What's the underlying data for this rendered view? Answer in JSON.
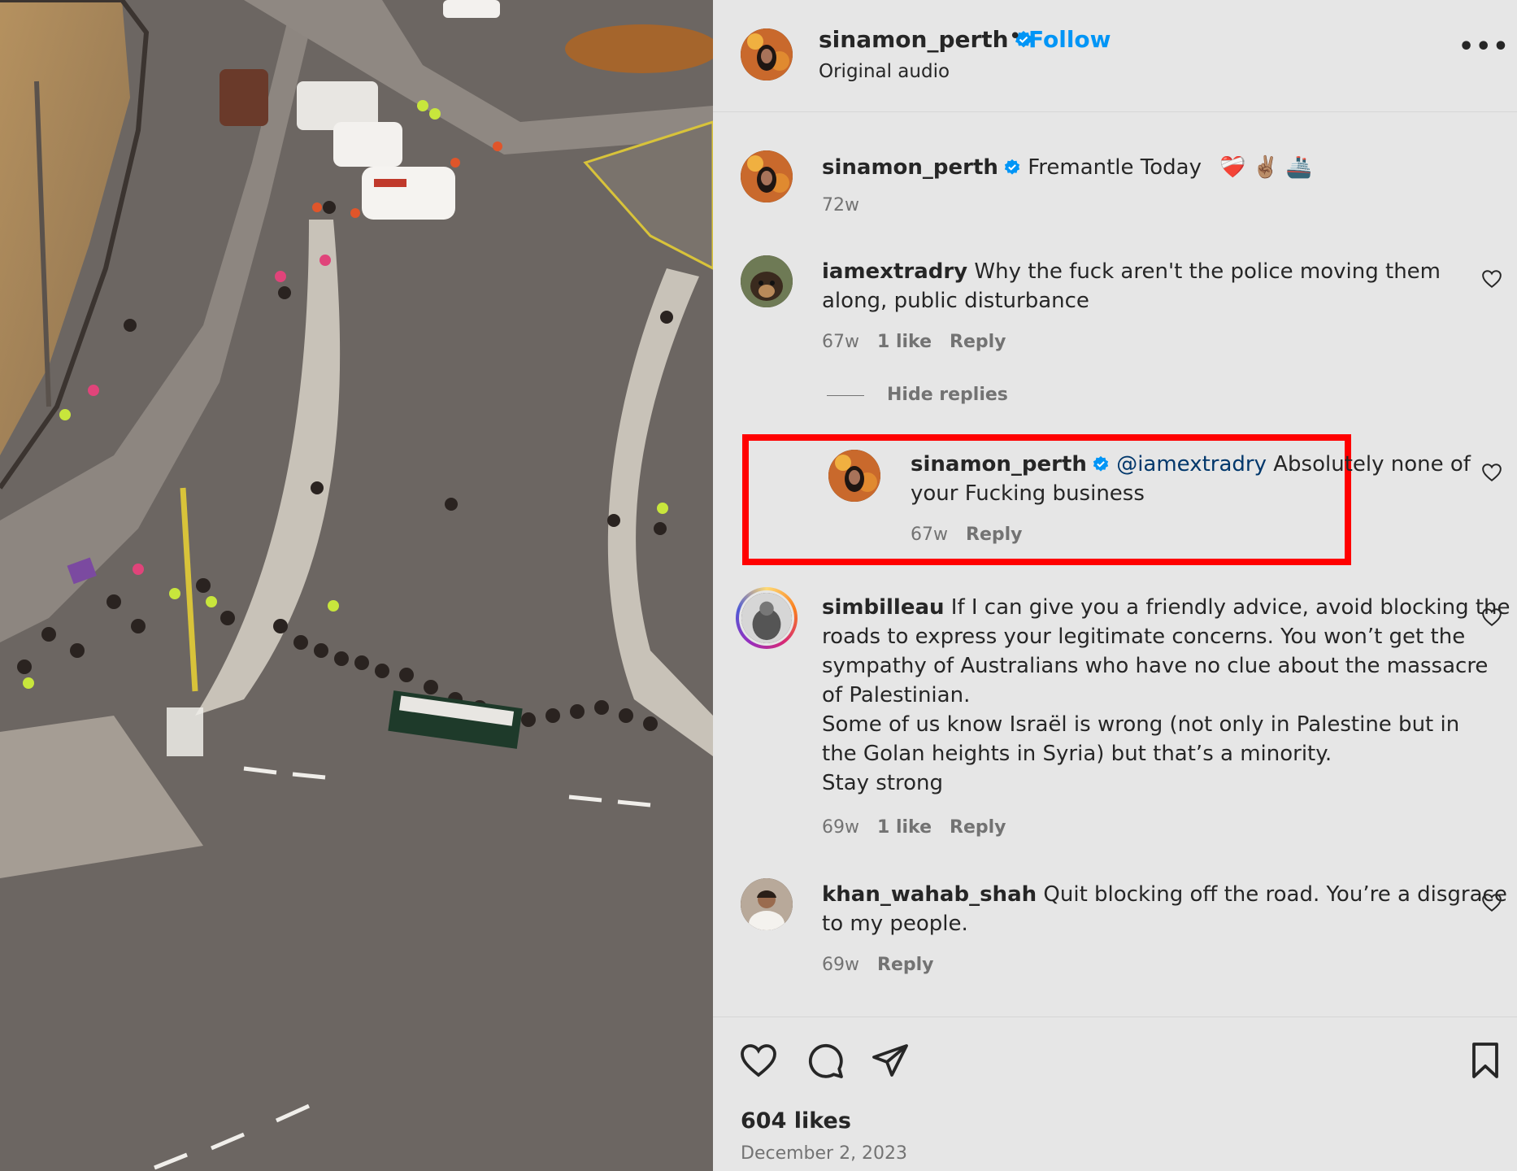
{
  "header": {
    "username": "sinamon_perth",
    "separator": "•",
    "follow_label": "Follow",
    "audio": "Original audio",
    "more_label": "•••"
  },
  "caption": {
    "username": "sinamon_perth",
    "text": "Fremantle Today",
    "emojis": "❤️‍🩹 ✌🏽 🚢",
    "age": "72w"
  },
  "comments": [
    {
      "username": "iamextradry",
      "text": "Why the fuck aren't the police moving them along, public disturbance",
      "line1": "Why the fuck aren't the police moving them",
      "line2": "along, public disturbance",
      "age": "67w",
      "likes": "1 like",
      "reply_label": "Reply"
    },
    {
      "hide_replies_label": "Hide replies"
    },
    {
      "username": "sinamon_perth",
      "mention": "@iamextradry",
      "text_after_mention": "Absolutely none of",
      "line2": "your Fucking business",
      "age": "67w",
      "reply_label": "Reply"
    },
    {
      "username": "simbilleau",
      "lines": [
        "If I can give you a friendly advice, avoid blocking the",
        "roads to express your legitimate concerns. You won’t get the",
        "sympathy of Australians who have no clue about the massacre",
        "of Palestinian.",
        "Some of us know Israël is wrong (not only in Palestine but in",
        "the Golan heights in Syria) but that’s a minority.",
        "Stay strong"
      ],
      "age": "69w",
      "likes": "1 like",
      "reply_label": "Reply"
    },
    {
      "username": "khan_wahab_shah",
      "line1": "Quit blocking off the road. You’re a disgrace",
      "line2": "to my people.",
      "age": "69w",
      "reply_label": "Reply"
    }
  ],
  "footer": {
    "likes": "604 likes",
    "date": "December 2, 2023"
  },
  "icons": {
    "verified": "verified-badge-icon",
    "like": "heart-icon",
    "comment": "comment-bubble-icon",
    "share": "paper-plane-icon",
    "save": "bookmark-icon",
    "more": "more-options-icon"
  },
  "colors": {
    "accent": "#0095f6",
    "mention": "#00376b",
    "highlight_border": "#ff0000",
    "muted_text": "#737373",
    "panel_bg": "#e6e6e6"
  }
}
